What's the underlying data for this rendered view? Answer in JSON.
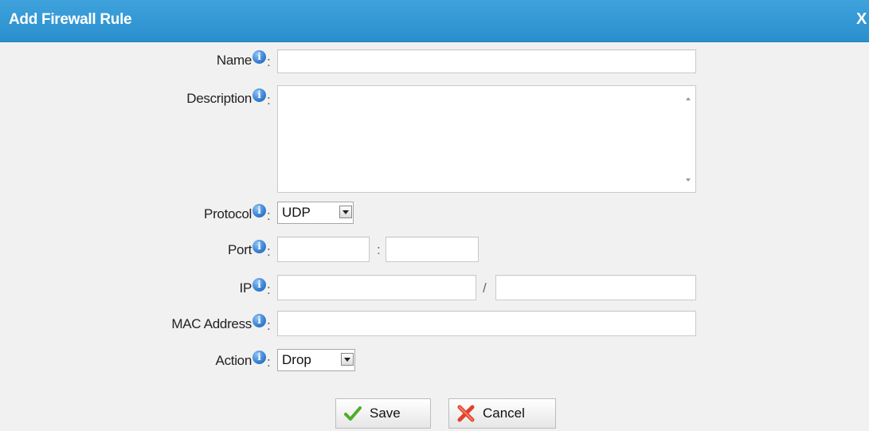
{
  "dialog": {
    "title": "Add Firewall Rule",
    "close_label": "X"
  },
  "fields": {
    "name": {
      "label": "Name",
      "value": "",
      "placeholder": ""
    },
    "description": {
      "label": "Description",
      "value": ""
    },
    "protocol": {
      "label": "Protocol",
      "selected": "UDP"
    },
    "port": {
      "label": "Port",
      "separator": ":",
      "start": "",
      "end": ""
    },
    "ip": {
      "label": "IP",
      "separator": "/",
      "address": "",
      "mask": ""
    },
    "mac": {
      "label": "MAC Address",
      "value": ""
    },
    "action": {
      "label": "Action",
      "selected": "Drop"
    }
  },
  "colon": ":",
  "info_glyph": "i",
  "buttons": {
    "save": "Save",
    "cancel": "Cancel"
  },
  "colors": {
    "titlebar": "#2a8fcd",
    "info_icon": "#3b84d6",
    "background": "#f1f1f1"
  }
}
